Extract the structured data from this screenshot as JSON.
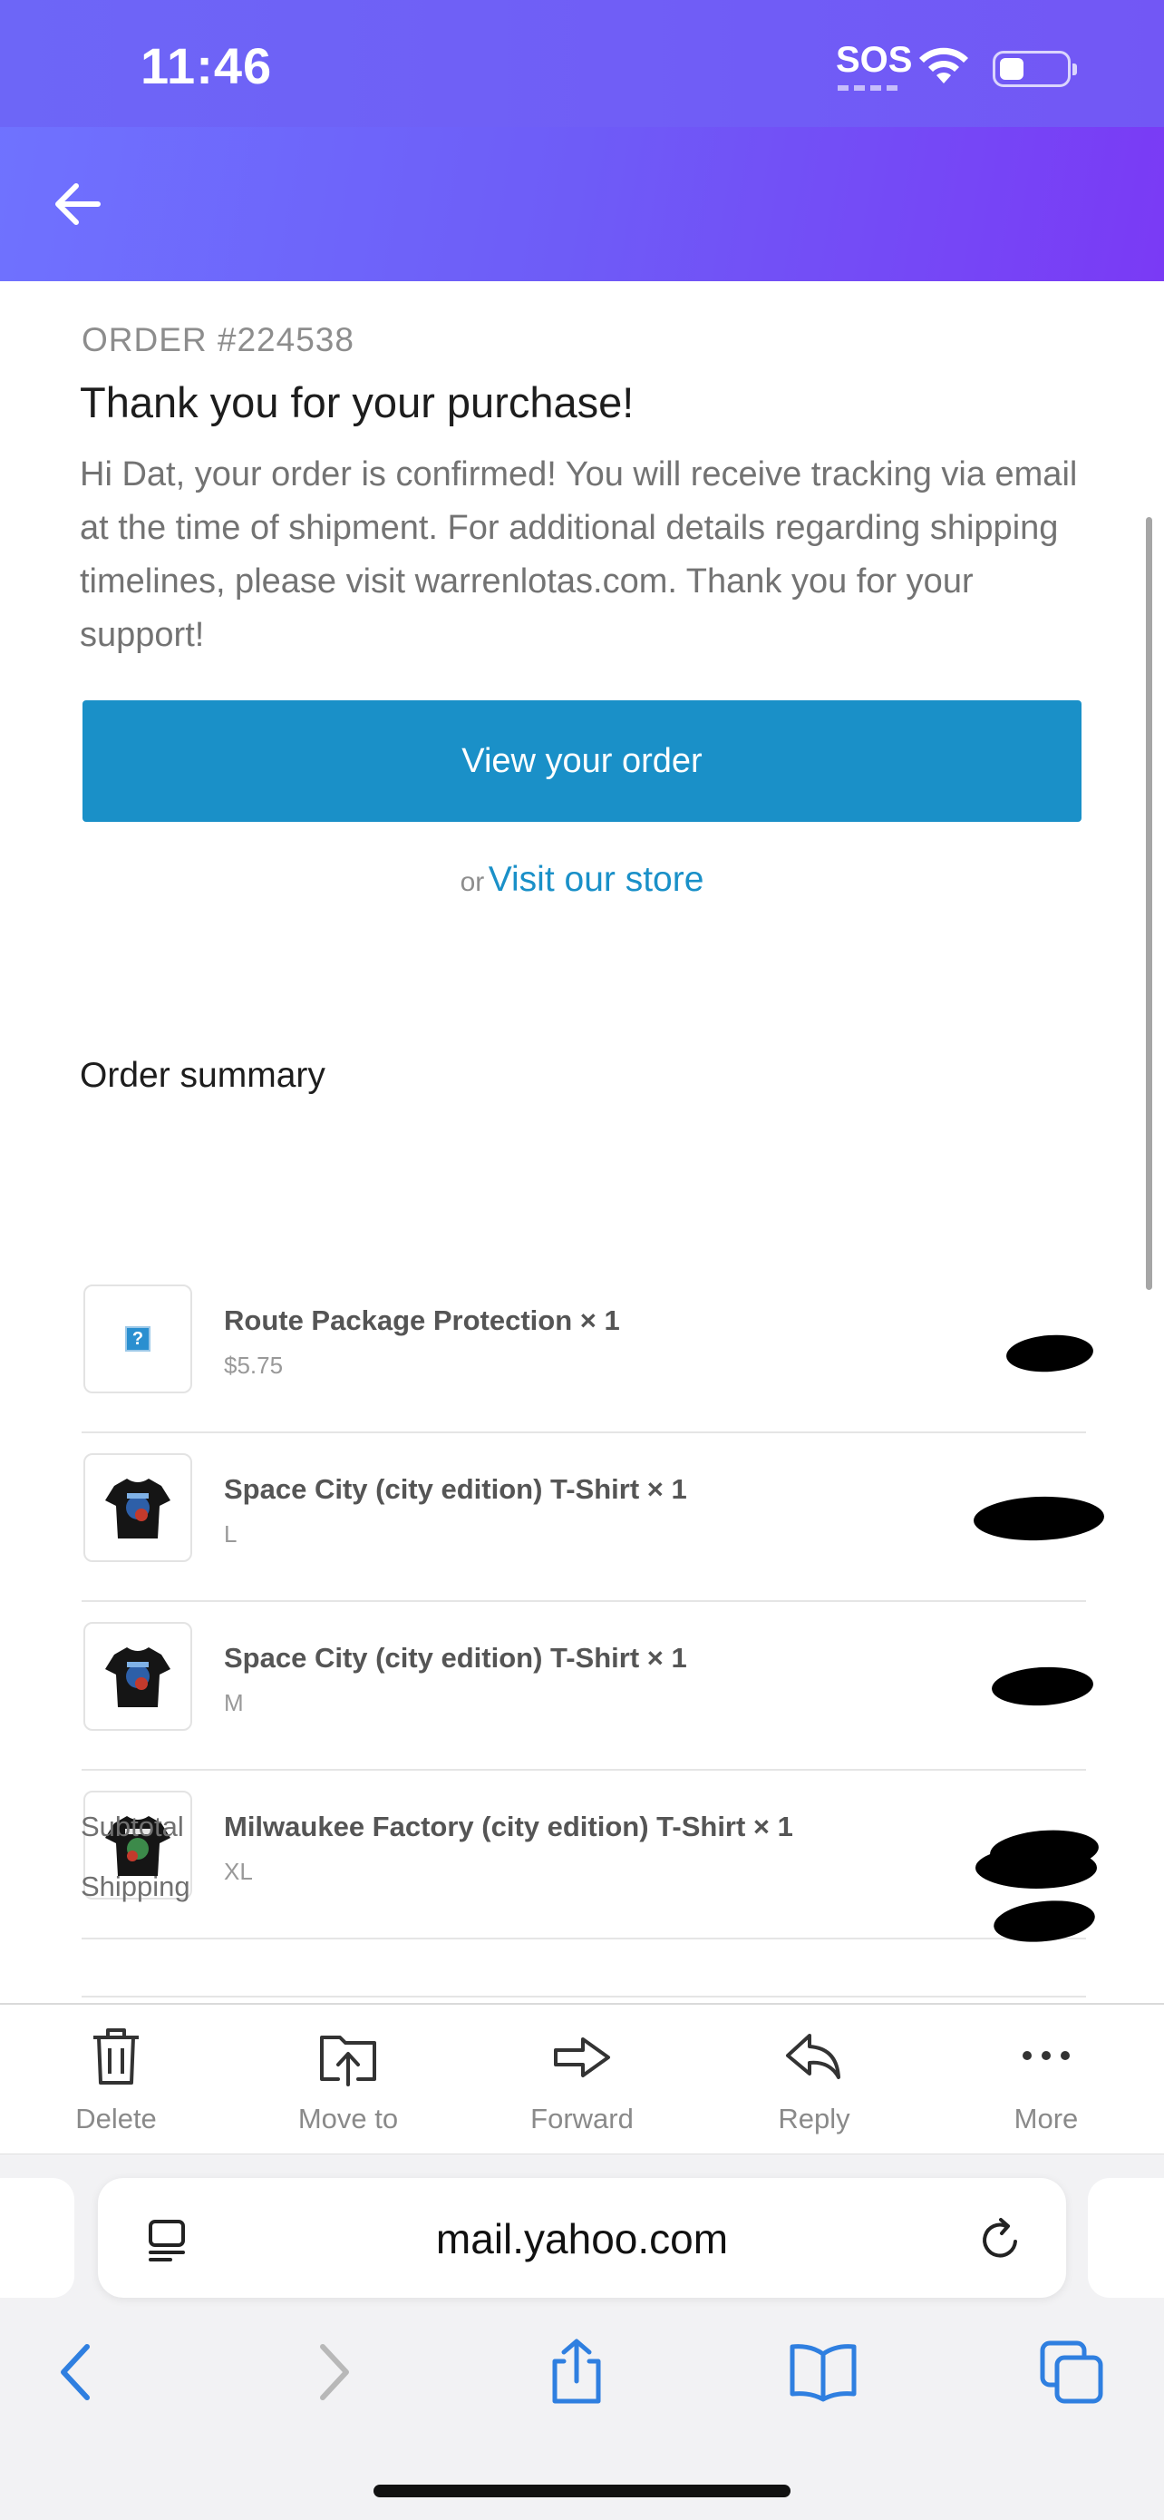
{
  "status_bar": {
    "time": "11:46",
    "sos": "SOS",
    "battery_level": 0.25
  },
  "header": {
    "back_icon": "arrow-left-icon"
  },
  "email": {
    "order_number": "ORDER #224538",
    "headline": "Thank you for your purchase!",
    "body": "Hi Dat, your order is confirmed! You will receive tracking via email at the time of shipment. For additional details regarding shipping timelines, please visit warrenlotas.com. Thank you for your support!",
    "view_order_label": "View your order",
    "or_text": "or",
    "visit_store_label": "Visit our store",
    "summary_title": "Order summary",
    "items": [
      {
        "name": "Route Package Protection × 1",
        "sub": "$5.75",
        "thumb": "question-icon"
      },
      {
        "name": "Space City (city edition) T-Shirt × 1",
        "sub": "L",
        "thumb": "tshirt-image"
      },
      {
        "name": "Space City (city edition) T-Shirt × 1",
        "sub": "M",
        "thumb": "tshirt-image"
      },
      {
        "name": "Milwaukee Factory (city edition) T-Shirt × 1",
        "sub": "XL",
        "thumb": "tshirt-image"
      }
    ],
    "totals": {
      "subtotal_label": "Subtotal",
      "shipping_label": "Shipping"
    }
  },
  "toolbar": {
    "delete": "Delete",
    "move_to": "Move to",
    "forward": "Forward",
    "reply": "Reply",
    "more": "More"
  },
  "browser": {
    "url": "mail.yahoo.com",
    "accent": "#2f7fe0"
  },
  "colors": {
    "header_start": "#6f73ff",
    "header_end": "#7a3af5",
    "button": "#1a90c8",
    "link": "#1a90c8"
  }
}
